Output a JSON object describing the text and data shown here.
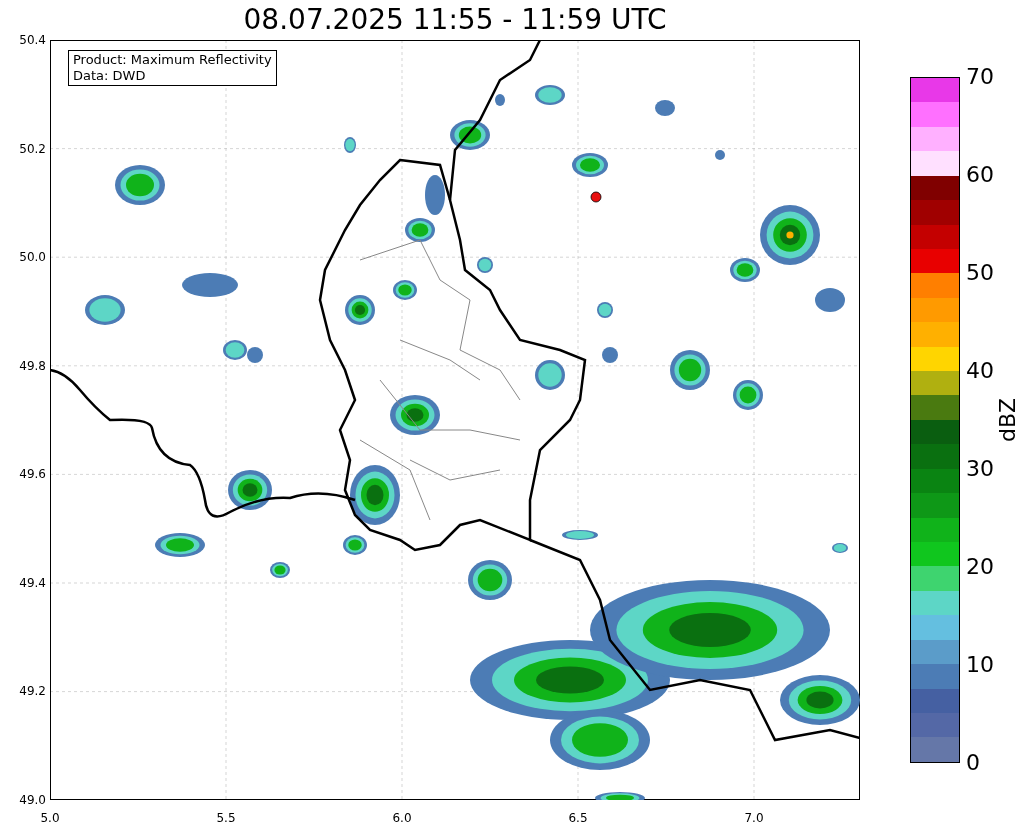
{
  "title": "08.07.2025 11:55 - 11:59 UTC",
  "legend": {
    "lines": [
      "Product: Maximum Reflectivity",
      "Data: DWD"
    ]
  },
  "y_ticks": [
    "50.4",
    "50.2",
    "50.0",
    "49.8",
    "49.6",
    "49.4",
    "49.2",
    "49.0"
  ],
  "x_ticks": [
    "5.0",
    "5.5",
    "6.0",
    "6.5",
    "7.0"
  ],
  "colorbar": {
    "label": "dBZ",
    "ticks": [
      "70",
      "60",
      "50",
      "40",
      "30",
      "20",
      "10",
      "0"
    ],
    "segments": [
      {
        "color": "#e838e8"
      },
      {
        "color": "#ff70ff"
      },
      {
        "color": "#ffb0ff"
      },
      {
        "color": "#ffe0ff"
      },
      {
        "color": "#800000"
      },
      {
        "color": "#a00000"
      },
      {
        "color": "#c40000"
      },
      {
        "color": "#e80000"
      },
      {
        "color": "#ff7f00"
      },
      {
        "color": "#ff9a00"
      },
      {
        "color": "#ffb000"
      },
      {
        "color": "#ffd500"
      },
      {
        "color": "#b0b010"
      },
      {
        "color": "#4a7a10"
      },
      {
        "color": "#0a5e10"
      },
      {
        "color": "#0a7010"
      },
      {
        "color": "#0a8412"
      },
      {
        "color": "#0e9817"
      },
      {
        "color": "#10b31a"
      },
      {
        "color": "#10c61e"
      },
      {
        "color": "#3ed46f"
      },
      {
        "color": "#5dd6c6"
      },
      {
        "color": "#64bfe0"
      },
      {
        "color": "#5b9cc9"
      },
      {
        "color": "#4c7cb5"
      },
      {
        "color": "#4560a2"
      },
      {
        "color": "#5468a6"
      },
      {
        "color": "#6577a8"
      }
    ]
  }
}
